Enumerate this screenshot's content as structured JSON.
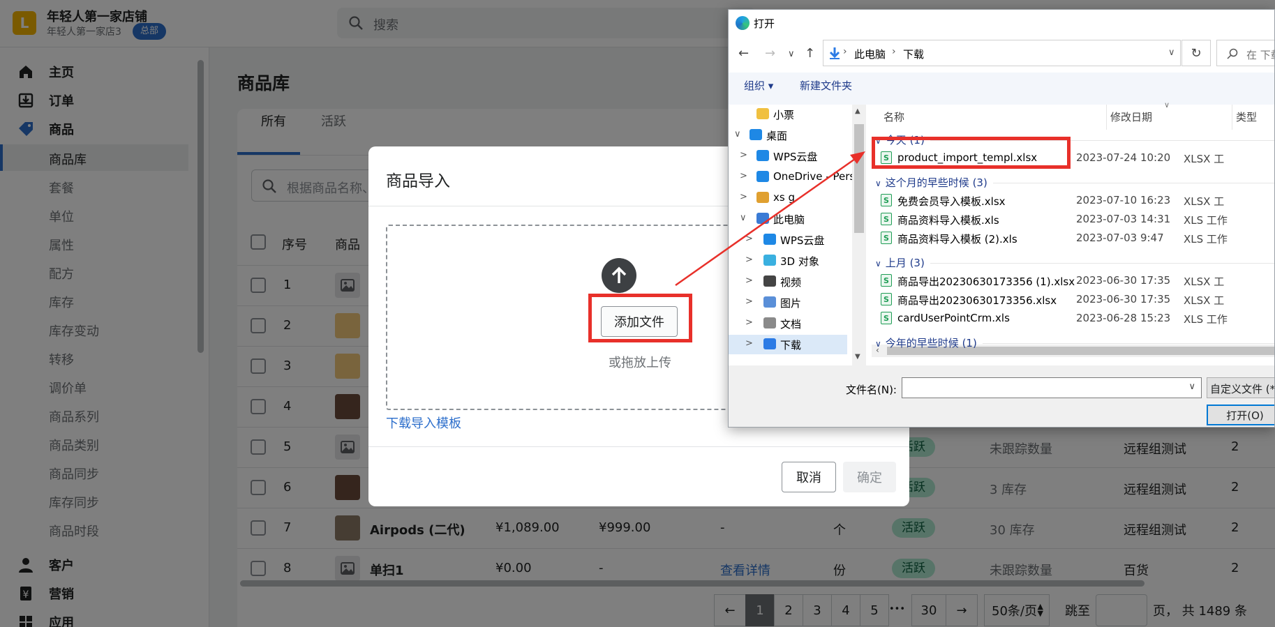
{
  "header": {
    "logo_letter": "L",
    "store_name": "年轻人第一家店铺",
    "store_sub": "年轻人第一家店3",
    "badge": "总部",
    "search_placeholder": "搜索"
  },
  "sidebar": {
    "top": [
      {
        "label": "主页",
        "icon": "home-icon"
      },
      {
        "label": "订单",
        "icon": "inbox-download-icon"
      },
      {
        "label": "商品",
        "icon": "tag-icon"
      }
    ],
    "sub": [
      "商品库",
      "套餐",
      "单位",
      "属性",
      "配方",
      "库存",
      "库存变动",
      "转移",
      "调价单",
      "商品系列",
      "商品类别",
      "商品同步",
      "库存同步",
      "商品时段"
    ],
    "bottom": [
      {
        "label": "客户",
        "icon": "person-icon"
      },
      {
        "label": "营销",
        "icon": "yen-icon"
      },
      {
        "label": "应用",
        "icon": "apps-icon"
      }
    ]
  },
  "main": {
    "title": "商品库",
    "tabs": [
      "所有",
      "活跃"
    ],
    "filter_placeholder": "根据商品名称、",
    "headers": [
      "序号",
      "商品"
    ],
    "rows": [
      {
        "no": "1",
        "thumb": "placeholder"
      },
      {
        "no": "2",
        "thumb": "food"
      },
      {
        "no": "3",
        "thumb": "food"
      },
      {
        "no": "4",
        "thumb": "dark"
      },
      {
        "no": "5",
        "thumb": "placeholder",
        "badge": "活跃",
        "stock": "未跟踪数量",
        "group": "远程组测试",
        "extra": "2"
      },
      {
        "no": "6",
        "thumb": "dark",
        "badge": "活跃",
        "stock": "3 库存",
        "group": "远程组测试",
        "extra": "2"
      },
      {
        "no": "7",
        "thumb": "photo",
        "name": "Airpods (二代)",
        "price": "¥1,089.00",
        "price2": "¥999.00",
        "detail": "-",
        "unit": "个",
        "badge": "活跃",
        "stock": "30 库存",
        "group": "远程组测试",
        "extra": "2"
      },
      {
        "no": "8",
        "thumb": "placeholder",
        "name": "单扫1",
        "price": "¥0.00",
        "price2": "-",
        "detail": "查看详情",
        "unit": "份",
        "badge": "活跃",
        "stock": "未跟踪数量",
        "group": "百货",
        "extra": "2"
      }
    ],
    "pagination": {
      "prev": "←",
      "pages": [
        "1",
        "2",
        "3",
        "4",
        "5"
      ],
      "ellipsis": "•••",
      "last": "30",
      "next": "→",
      "page_size": "50条/页",
      "jump_label": "跳至",
      "total": "页， 共 1489 条"
    }
  },
  "modal": {
    "title": "商品导入",
    "add_file": "添加文件",
    "drop_hint": "或拖放上传",
    "download_template": "下载导入模板",
    "cancel": "取消",
    "confirm": "确定"
  },
  "file_dialog": {
    "title": "打开",
    "path": [
      "此电脑",
      "下载"
    ],
    "search_placeholder": "在 下载",
    "organize": "组织 ▾",
    "new_folder": "新建文件夹",
    "tree": [
      {
        "label": "小票",
        "indent": 1,
        "chev": "",
        "color": "#f0c040"
      },
      {
        "label": "桌面",
        "indent": 0,
        "chev": "∨",
        "color": "#1e88e5"
      },
      {
        "label": "WPS云盘",
        "indent": 1,
        "chev": ">",
        "color": "#1e88e5"
      },
      {
        "label": "OneDrive - Pers",
        "indent": 1,
        "chev": ">",
        "color": "#1e88e5"
      },
      {
        "label": "xs g",
        "indent": 1,
        "chev": ">",
        "color": "#e0a030"
      },
      {
        "label": "此电脑",
        "indent": 1,
        "chev": "∨",
        "color": "#3a7bd5"
      },
      {
        "label": "WPS云盘",
        "indent": 2,
        "chev": ">",
        "color": "#1e88e5"
      },
      {
        "label": "3D 对象",
        "indent": 2,
        "chev": ">",
        "color": "#3ab0e0"
      },
      {
        "label": "视频",
        "indent": 2,
        "chev": ">",
        "color": "#444"
      },
      {
        "label": "图片",
        "indent": 2,
        "chev": ">",
        "color": "#5a8fd8"
      },
      {
        "label": "文档",
        "indent": 2,
        "chev": ">",
        "color": "#8a8a8a"
      },
      {
        "label": "下载",
        "indent": 2,
        "chev": ">",
        "color": "#2c7be5"
      }
    ],
    "columns": [
      "名称",
      "修改日期",
      "类型"
    ],
    "groups": [
      {
        "label": "今天 (1)",
        "files": [
          {
            "name": "product_import_templ.xlsx",
            "date": "2023-07-24 10:20",
            "type": "XLSX 工"
          }
        ]
      },
      {
        "label": "这个月的早些时候 (3)",
        "files": [
          {
            "name": "免费会员导入模板.xlsx",
            "date": "2023-07-10 16:23",
            "type": "XLSX 工"
          },
          {
            "name": "商品资料导入模板.xls",
            "date": "2023-07-03 14:31",
            "type": "XLS 工作"
          },
          {
            "name": "商品资料导入模板 (2).xls",
            "date": "2023-07-03 9:47",
            "type": "XLS 工作"
          }
        ]
      },
      {
        "label": "上月 (3)",
        "files": [
          {
            "name": "商品导出20230630173356 (1).xlsx",
            "date": "2023-06-30 17:35",
            "type": "XLSX 工"
          },
          {
            "name": "商品导出20230630173356.xlsx",
            "date": "2023-06-30 17:35",
            "type": "XLSX 工"
          },
          {
            "name": "cardUserPointCrm.xls",
            "date": "2023-06-28 15:23",
            "type": "XLS 工作"
          }
        ]
      },
      {
        "label": "今年的早些时候 (1)",
        "files": []
      }
    ],
    "filename_label": "文件名(N):",
    "filetype": "自定义文件 (*.",
    "open": "打开(O)"
  }
}
